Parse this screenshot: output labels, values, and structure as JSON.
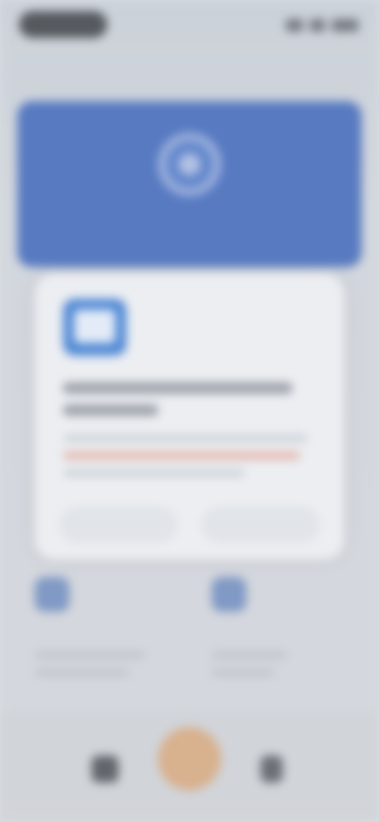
{
  "status_bar": {
    "time": "",
    "icons": [
      "signal-icon",
      "wifi-icon",
      "battery-icon"
    ]
  },
  "header": {
    "title": ""
  },
  "hero": {
    "icon": "globe-icon",
    "label": ""
  },
  "cards": [
    {
      "icon": "card-icon",
      "title": ""
    },
    {
      "icon": "card-icon",
      "title": ""
    }
  ],
  "dialog": {
    "icon": "app-icon",
    "title": "",
    "body": "",
    "secondary_button": "",
    "primary_button": ""
  },
  "tab_bar": {
    "items": [
      "home-icon",
      "action-icon",
      "more-icon"
    ]
  },
  "colors": {
    "hero_blue": "#1b4fb8",
    "accent_orange": "#e0a36a",
    "dialog_bg": "#eceef2"
  }
}
